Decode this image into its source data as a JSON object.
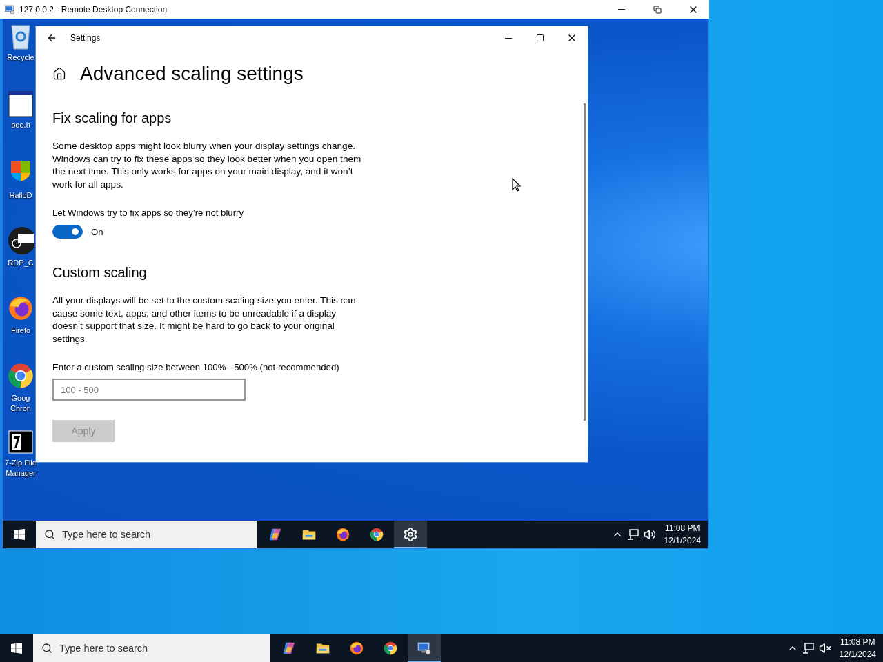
{
  "rdp_window": {
    "title": "127.0.0.2 - Remote Desktop Connection"
  },
  "remote_desktop": {
    "icons": [
      {
        "kind": "recycle",
        "lines": [
          "Recycle"
        ]
      },
      {
        "kind": "window",
        "lines": [
          "boo.h"
        ]
      },
      {
        "kind": "shield",
        "lines": [
          "HalloD"
        ]
      },
      {
        "kind": "rdp",
        "lines": [
          "RDP_C"
        ]
      },
      {
        "kind": "firefox",
        "lines": [
          "Firefo"
        ]
      },
      {
        "kind": "chrome",
        "lines": [
          "Goog",
          "Chron"
        ]
      },
      {
        "kind": "zip",
        "lines": [
          "7-Zip File",
          "Manager"
        ]
      }
    ]
  },
  "settings": {
    "title": "Settings",
    "page_title": "Advanced scaling settings",
    "fix_section": {
      "heading": "Fix scaling for apps",
      "text": "Some desktop apps might look blurry when your display settings change. Windows can try to fix these apps so they look better when you open them the next time. This only works for apps on your main display, and it won’t work for all apps.",
      "toggle_label": "Let Windows try to fix apps so they’re not blurry",
      "toggle": {
        "on": true,
        "state_text": "On"
      }
    },
    "custom_section": {
      "heading": "Custom scaling",
      "text": "All your displays will be set to the custom scaling size you enter. This can cause some text, apps, and other items to be unreadable if a display doesn’t support that size. It might be hard to go back to your original settings.",
      "field_label": "Enter a custom scaling size between 100% - 500% (not recommended)",
      "field": {
        "placeholder": "100 - 500"
      },
      "apply": {
        "label": "Apply",
        "disabled": true
      }
    }
  },
  "inner_taskbar": {
    "search_placeholder": "Type here to search",
    "apps": [
      {
        "kind": "copilot",
        "selected": false
      },
      {
        "kind": "folder",
        "selected": false
      },
      {
        "kind": "firefox",
        "selected": false
      },
      {
        "kind": "chrome",
        "selected": false
      },
      {
        "kind": "settings",
        "selected": true
      }
    ],
    "volume_muted": false,
    "time": "11:08 PM",
    "date": "12/1/2024"
  },
  "outer_taskbar": {
    "search_placeholder": "Type here to search",
    "apps": [
      {
        "kind": "copilot",
        "selected": false
      },
      {
        "kind": "folder",
        "selected": false
      },
      {
        "kind": "firefox",
        "selected": false
      },
      {
        "kind": "chrome",
        "selected": false
      },
      {
        "kind": "rdp",
        "selected": true
      }
    ],
    "volume_muted": true,
    "time": "11:08 PM",
    "date": "12/1/2024"
  }
}
